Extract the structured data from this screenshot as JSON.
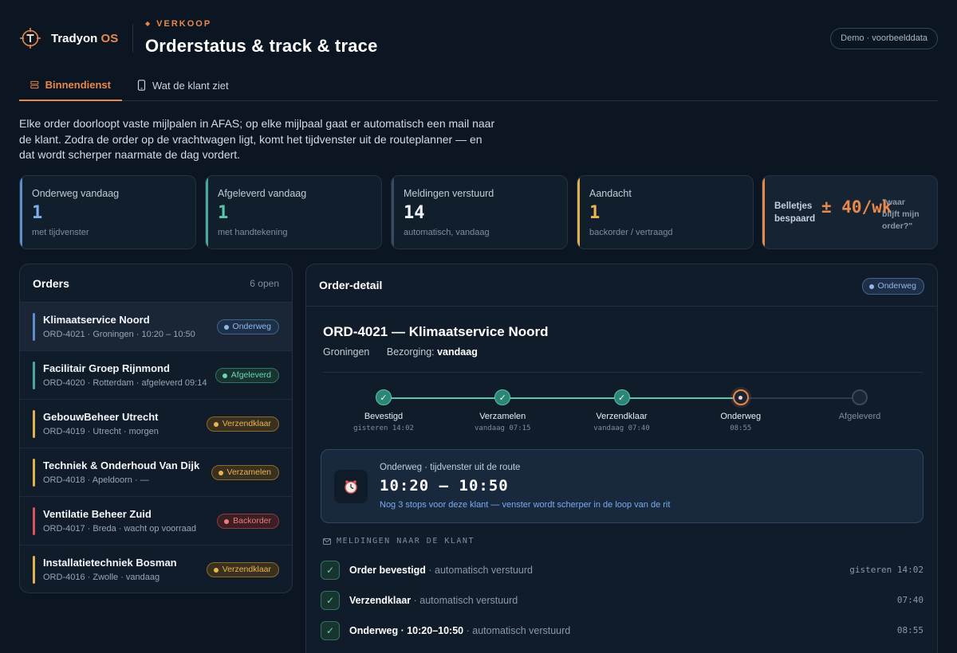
{
  "app": {
    "brand_name": "Tradyon",
    "brand_suffix": "OS",
    "accent": "#e8894a"
  },
  "header": {
    "eyebrow": "VERKOOP",
    "title": "Orderstatus & track & trace",
    "demo_pill": "Demo · voorbeelddata"
  },
  "tabs": [
    {
      "label": "Binnendienst",
      "icon": "server-icon",
      "active": true
    },
    {
      "label": "Wat de klant ziet",
      "icon": "phone-icon",
      "active": false
    }
  ],
  "intro": "Elke order doorloopt vaste mijlpalen in AFAS; op elke mijlpaal gaat er automatisch een mail naar de klant. Zodra de order op de vrachtwagen ligt, komt het tijdvenster uit de routeplanner — en dat wordt scherper naarmate de dag vordert.",
  "stats": [
    {
      "label": "Onderweg vandaag",
      "value": "1",
      "sub": "met tijdvenster",
      "color": "#7eaef0"
    },
    {
      "label": "Afgeleverd vandaag",
      "value": "1",
      "sub": "met handtekening",
      "color": "#58c6b0"
    },
    {
      "label": "Meldingen verstuurd",
      "value": "14",
      "sub": "automatisch, vandaag",
      "color": "#f0f4f8"
    },
    {
      "label": "Aandacht",
      "value": "1",
      "sub": "backorder / vertraagd",
      "color": "#eab44e"
    }
  ],
  "savings": {
    "label_line1": "Belletjes",
    "label_line2": "bespaard",
    "value": "± 40/wk",
    "quote_line1": "\"waar",
    "quote_line2": "blijft mijn",
    "quote_line3": "order?\""
  },
  "orders": {
    "title": "Orders",
    "count": "6 open",
    "items": [
      {
        "name": "Klimaatservice Noord",
        "meta": "ORD-4021 · Groningen · 10:20 – 10:50",
        "status": "Onderweg",
        "tone": "blue",
        "accent": "#5e8ec9",
        "selected": true
      },
      {
        "name": "Facilitair Groep Rijnmond",
        "meta": "ORD-4020 · Rotterdam · afgeleverd 09:14",
        "status": "Afgeleverd",
        "tone": "green",
        "accent": "#47a99a",
        "selected": false
      },
      {
        "name": "GebouwBeheer Utrecht",
        "meta": "ORD-4019 · Utrecht · morgen",
        "status": "Verzendklaar",
        "tone": "amber",
        "accent": "#e3b04a",
        "selected": false
      },
      {
        "name": "Techniek & Onderhoud Van Dijk",
        "meta": "ORD-4018 · Apeldoorn · —",
        "status": "Verzamelen",
        "tone": "amber",
        "accent": "#e3b04a",
        "selected": false
      },
      {
        "name": "Ventilatie Beheer Zuid",
        "meta": "ORD-4017 · Breda · wacht op voorraad",
        "status": "Backorder",
        "tone": "red",
        "accent": "#d9545a",
        "selected": false
      },
      {
        "name": "Installatietechniek Bosman",
        "meta": "ORD-4016 · Zwolle · vandaag",
        "status": "Verzendklaar",
        "tone": "amber",
        "accent": "#e3b04a",
        "selected": false
      }
    ]
  },
  "detail": {
    "title": "Order-detail",
    "status": "Onderweg",
    "heading": "ORD-4021 — Klimaatservice Noord",
    "city": "Groningen",
    "delivery_label": "Bezorging:",
    "delivery_value": "vandaag",
    "steps": [
      {
        "label": "Bevestigd",
        "time": "gisteren 14:02",
        "state": "done"
      },
      {
        "label": "Verzamelen",
        "time": "vandaag 07:15",
        "state": "done"
      },
      {
        "label": "Verzendklaar",
        "time": "vandaag 07:40",
        "state": "done"
      },
      {
        "label": "Onderweg",
        "time": "08:55",
        "state": "current"
      },
      {
        "label": "Afgeleverd",
        "time": "",
        "state": "todo"
      }
    ],
    "eta": {
      "label": "Onderweg · tijdvenster uit de route",
      "window": "10:20 – 10:50",
      "note": "Nog 3 stops voor deze klant — venster wordt scherper in de loop van de rit",
      "icon": "clock-icon"
    },
    "notifications_title": "MELDINGEN NAAR DE KLANT",
    "notifications": [
      {
        "event": "Order bevestigd",
        "suffix": "· automatisch verstuurd",
        "time": "gisteren 14:02"
      },
      {
        "event": "Verzendklaar",
        "suffix": "· automatisch verstuurd",
        "time": "07:40"
      },
      {
        "event": "Onderweg · 10:20–10:50",
        "suffix": "· automatisch verstuurd",
        "time": "08:55"
      }
    ]
  }
}
